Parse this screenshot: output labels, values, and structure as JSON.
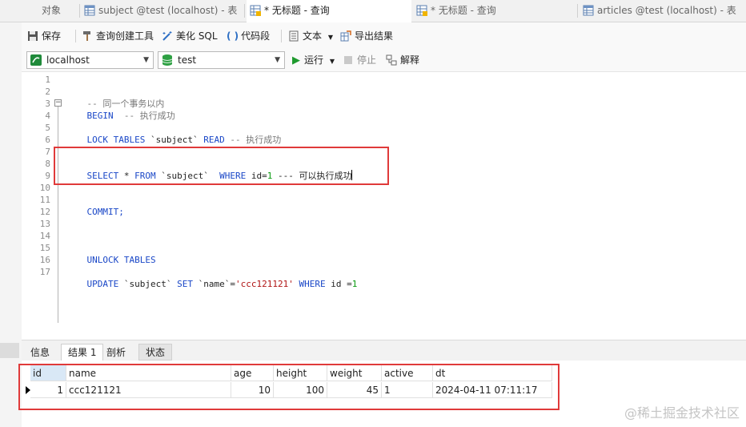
{
  "tabs": [
    {
      "label": "对象",
      "icon": "none"
    },
    {
      "label": "subject @test (localhost) - 表",
      "icon": "table-icon"
    },
    {
      "label": "* 无标题 - 查询",
      "icon": "query-icon"
    },
    {
      "label": "* 无标题 - 查询",
      "icon": "query-icon"
    },
    {
      "label": "articles @test (localhost) - 表",
      "icon": "table-icon"
    }
  ],
  "toolbar": {
    "save": "保存",
    "query_builder": "查询创建工具",
    "beautify": "美化 SQL",
    "snippet": "代码段",
    "text": "文本",
    "export": "导出结果"
  },
  "connection": {
    "server": "localhost",
    "database": "test",
    "run": "运行",
    "stop": "停止",
    "explain": "解释"
  },
  "editor": {
    "line_numbers": [
      "1",
      "2",
      "3",
      "4",
      "5",
      "6",
      "7",
      "8",
      "9",
      "10",
      "11",
      "12",
      "13",
      "14",
      "15",
      "16",
      "17"
    ],
    "lines": {
      "l2_comment": "-- 同一个事务以内",
      "l3_begin": "BEGIN",
      "l3_comment": "  -- 执行成功",
      "l5_lock": "LOCK TABLES",
      "l5_table": " `subject` ",
      "l5_read": "READ",
      "l5_comment": " -- 执行成功",
      "l8_select": "SELECT",
      "l8_star": " * ",
      "l8_from": "FROM",
      "l8_table": " `subject`  ",
      "l8_where": "WHERE",
      "l8_cond": " id=",
      "l8_val": "1",
      "l8_comment": " --- 可以执行成功",
      "l11_commit": "COMMIT;",
      "l15_unlock": "UNLOCK TABLES",
      "l17_update": "UPDATE",
      "l17_table": " `subject` ",
      "l17_set": "SET",
      "l17_col": " `name`=",
      "l17_str": "'ccc121121'",
      "l17_where": " WHERE",
      "l17_cond": " id =",
      "l17_val": "1"
    }
  },
  "result_tabs": [
    "信息",
    "结果 1",
    "剖析",
    "状态"
  ],
  "result": {
    "columns": [
      "id",
      "name",
      "age",
      "height",
      "weight",
      "active",
      "dt"
    ],
    "rows": [
      [
        "1",
        "ccc121121",
        "10",
        "100",
        "45",
        "1",
        "2024-04-11 07:11:17"
      ]
    ]
  },
  "watermark": "@稀土掘金技术社区",
  "colors": {
    "keyword": "#1a47c7",
    "comment": "#777777",
    "number": "#0a9a10",
    "string": "#b01414",
    "highlight": "#e03a3a"
  }
}
